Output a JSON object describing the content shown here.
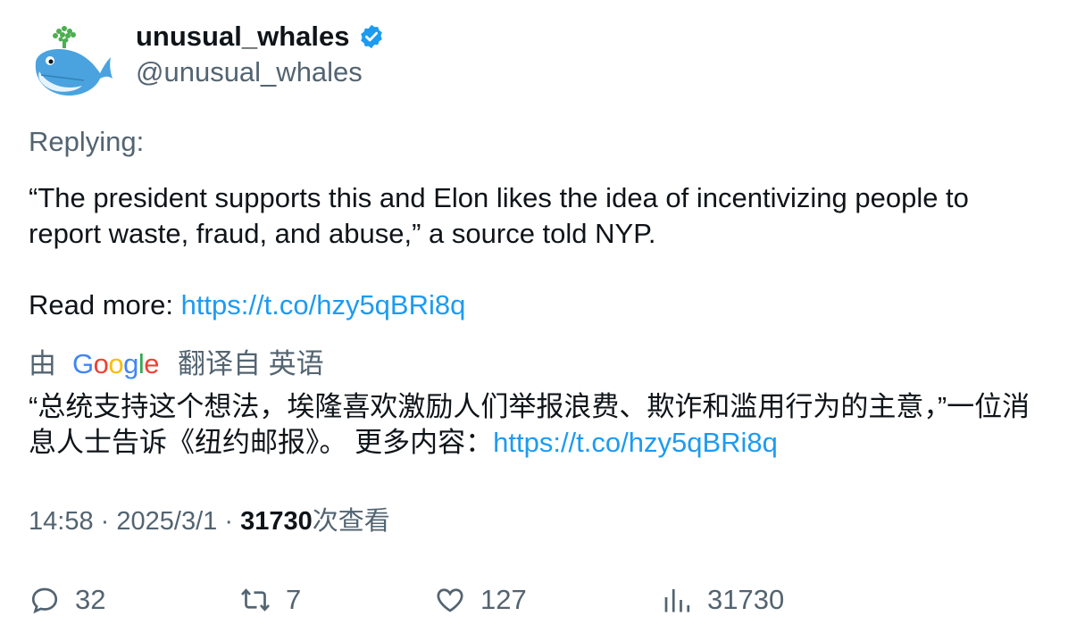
{
  "author": {
    "display_name": "unusual_whales",
    "handle": "@unusual_whales",
    "verified": true,
    "avatar_icon": "whale-avatar-icon"
  },
  "tweet": {
    "replying_label": "Replying:",
    "body": "“The president supports this and Elon likes the idea of incentivizing people to report waste, fraud, and abuse,” a source told NYP.",
    "read_more_label": "Read more: ",
    "link": "https://t.co/hzy5qBRi8q"
  },
  "translation": {
    "by_label": "由",
    "provider": "Google",
    "from_label": "翻译自 英语",
    "text": "“总统支持这个想法，埃隆喜欢激励人们举报浪费、欺诈和滥用行为的主意，”一位消息人士告诉《纽约邮报》。 更多内容：",
    "link": "https://t.co/hzy5qBRi8q"
  },
  "meta": {
    "time": "14:58",
    "separator": "·",
    "date": "2025/3/1",
    "views": "31730",
    "views_label": "次查看"
  },
  "actions": {
    "replies": "32",
    "retweets": "7",
    "likes": "127",
    "views": "31730"
  },
  "colors": {
    "link": "#1d9bf0",
    "secondary": "#536471",
    "primary": "#0f1419",
    "verified": "#1d9bf0"
  }
}
